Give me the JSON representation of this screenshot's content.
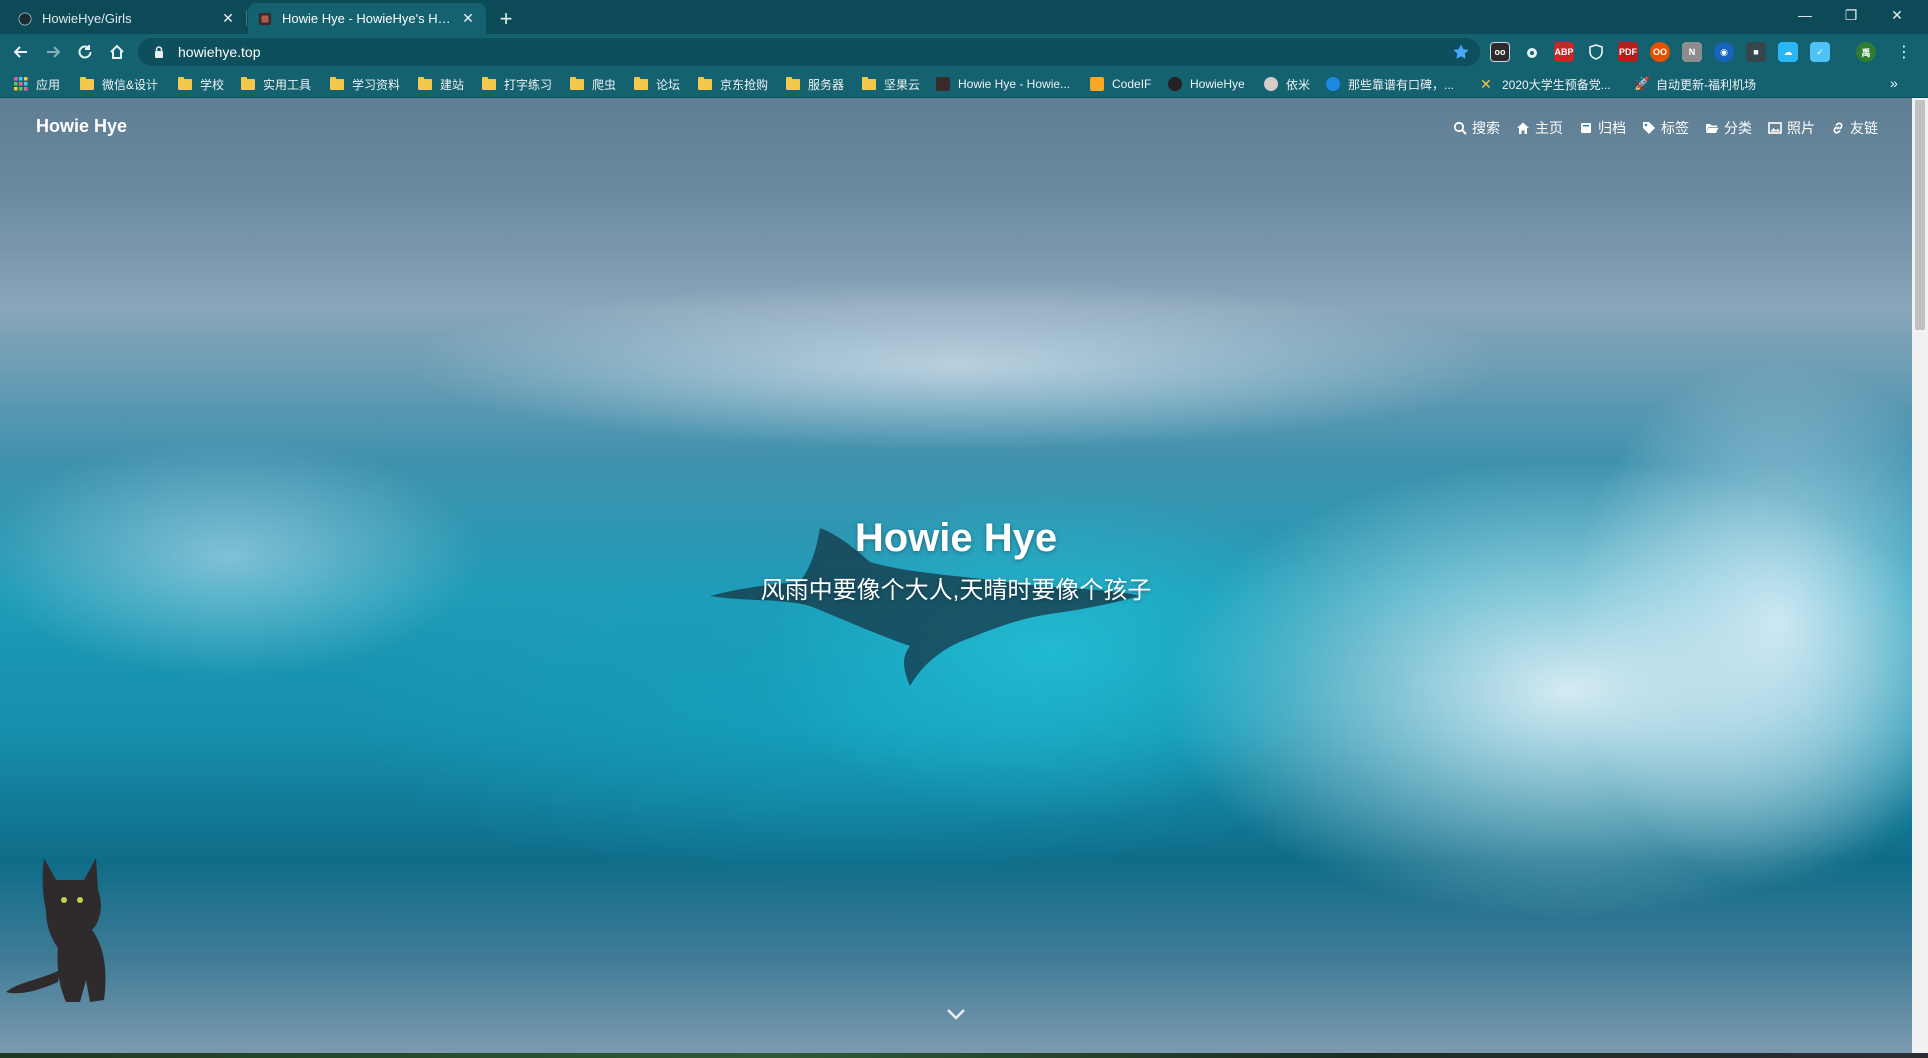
{
  "browser": {
    "tabs": [
      {
        "title": "HowieHye/Girls",
        "active": false
      },
      {
        "title": "Howie Hye - HowieHye's HomePage",
        "active": true
      }
    ],
    "url": "howiehye.top",
    "bookmarks": [
      {
        "label": "应用",
        "kind": "apps"
      },
      {
        "label": "微信&设计",
        "kind": "folder"
      },
      {
        "label": "学校",
        "kind": "folder"
      },
      {
        "label": "实用工具",
        "kind": "folder"
      },
      {
        "label": "学习资料",
        "kind": "folder"
      },
      {
        "label": "建站",
        "kind": "folder"
      },
      {
        "label": "打字练习",
        "kind": "folder"
      },
      {
        "label": "爬虫",
        "kind": "folder"
      },
      {
        "label": "论坛",
        "kind": "folder"
      },
      {
        "label": "京东抢购",
        "kind": "folder"
      },
      {
        "label": "服务器",
        "kind": "folder"
      },
      {
        "label": "坚果云",
        "kind": "folder"
      },
      {
        "label": "Howie Hye - Howie...",
        "kind": "page"
      },
      {
        "label": "CodeIF",
        "kind": "page"
      },
      {
        "label": "HowieHye",
        "kind": "page"
      },
      {
        "label": "依米",
        "kind": "page"
      },
      {
        "label": "那些靠谱有口碑，...",
        "kind": "page"
      },
      {
        "label": "2020大学生预备党...",
        "kind": "page"
      },
      {
        "label": "自动更新-福利机场",
        "kind": "page"
      }
    ],
    "more_bookmarks": "»"
  },
  "site": {
    "brand": "Howie Hye",
    "nav": [
      {
        "label": "搜索",
        "icon": "search-icon"
      },
      {
        "label": "主页",
        "icon": "home-icon"
      },
      {
        "label": "归档",
        "icon": "archive-icon"
      },
      {
        "label": "标签",
        "icon": "tags-icon"
      },
      {
        "label": "分类",
        "icon": "folder-open-icon"
      },
      {
        "label": "照片",
        "icon": "image-icon"
      },
      {
        "label": "友链",
        "icon": "link-icon"
      }
    ],
    "hero": {
      "title": "Howie Hye",
      "subtitle": "风雨中要像个大人,天晴时要像个孩子"
    }
  },
  "colors": {
    "tab_strip": "#0c4a58",
    "toolbar": "#146170",
    "accent": "#1e9cb7"
  }
}
